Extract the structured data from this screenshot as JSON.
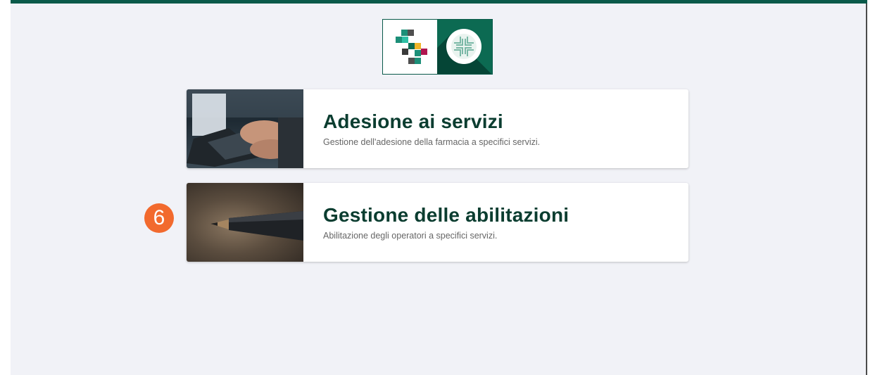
{
  "header": {
    "accent_color": "#0a5a4a"
  },
  "logo": {
    "left_icon": "pixel-s-logo-icon",
    "right_icon": "pharmacy-cross-icon"
  },
  "cards": [
    {
      "title": "Adesione ai servizi",
      "subtitle": "Gestione dell'adesione della farmacia a specifici servizi.",
      "image_icon": "laptop-typing-image"
    },
    {
      "title": "Gestione delle abilitazioni",
      "subtitle": "Abilitazione degli operatori a specifici servizi.",
      "image_icon": "pencil-image"
    }
  ],
  "step_badge": {
    "label": "6",
    "color": "#f26a2e"
  }
}
